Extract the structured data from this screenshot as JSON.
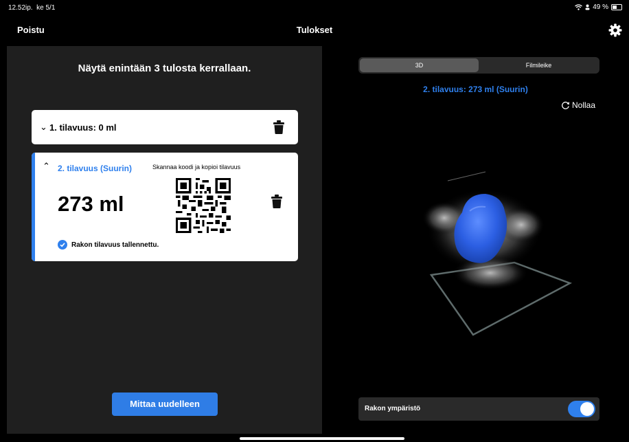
{
  "status": {
    "time": "12.52ip.",
    "date": "ke 5/1",
    "battery": "49 %",
    "battery_level": 0.49
  },
  "nav": {
    "exit_label": "Poistu",
    "title": "Tulokset",
    "settings_icon": "gear-icon"
  },
  "left": {
    "heading": "Näytä enintään 3 tulosta kerrallaan.",
    "card1": {
      "label": "1. tilavuus: 0 ml"
    },
    "card2": {
      "title": "2. tilavuus (Suurin)",
      "scan_label": "Skannaa koodi ja kopioi tilavuus",
      "volume": "273 ml",
      "saved_label": "Rakon tilavuus tallennettu."
    },
    "measure_button": "Mittaa uudelleen"
  },
  "right": {
    "tabs": [
      "3D",
      "Filmileike"
    ],
    "selected_tab": "3D",
    "volume_heading": "2. tilavuus: 273 ml (Suurin)",
    "reset_label": "Nollaa",
    "env_label": "Rakon ympäristö",
    "env_toggle_on": true
  },
  "colors": {
    "accent": "#2f80ed",
    "button": "#2f7de6",
    "panel": "#1f1f1f"
  }
}
